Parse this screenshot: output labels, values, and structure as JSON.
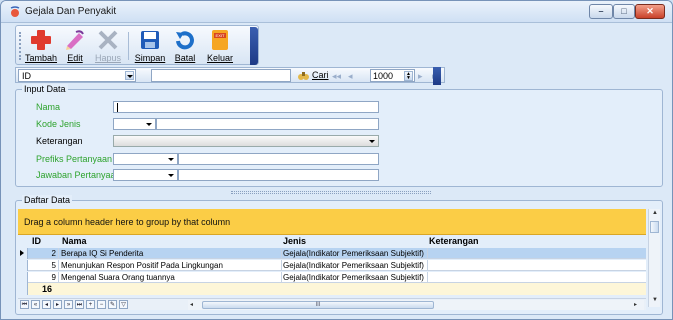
{
  "window": {
    "title": "Gejala Dan Penyakit"
  },
  "toolbar": {
    "tambah": "Tambah",
    "edit": "Edit",
    "hapus": "Hapus",
    "simpan": "Simpan",
    "batal": "Batal",
    "keluar": "Keluar"
  },
  "findbar": {
    "field": "ID",
    "cari": "Cari",
    "count": "1000"
  },
  "input_group": {
    "title": "Input Data",
    "nama": "Nama",
    "kode_jenis": "Kode Jenis",
    "keterangan": "Keterangan",
    "prefiks": "Prefiks Pertanyaan",
    "jawaban": "Jawaban Pertanyaan"
  },
  "list_group": {
    "title": "Daftar Data",
    "group_hint": "Drag a column header here to group by that column",
    "columns": {
      "id": "ID",
      "nama": "Nama",
      "jenis": "Jenis",
      "keterangan": "Keterangan"
    },
    "rows": [
      {
        "id": "2",
        "nama": "Berapa IQ Si Penderita",
        "jenis": "Gejala(Indikator Pemeriksaan Subjektif)",
        "keterangan": ""
      },
      {
        "id": "5",
        "nama": "Menunjukan Respon Positif Pada Lingkungan",
        "jenis": "Gejala(Indikator Pemeriksaan Subjektif)",
        "keterangan": ""
      },
      {
        "id": "9",
        "nama": "Mengenal Suara Orang tuannya",
        "jenis": "Gejala(Indikator Pemeriksaan Subjektif)",
        "keterangan": ""
      }
    ],
    "footer_total": "16",
    "scroll_grip": "III"
  },
  "icons": {
    "app": "stethoscope-icon",
    "add": "plus-icon",
    "edit": "pencil-icon",
    "delete": "x-icon",
    "save": "floppy-icon",
    "undo": "undo-icon",
    "exit": "exit-icon",
    "find": "binoculars-icon"
  },
  "colors": {
    "group_bar": "#fbcd46",
    "selected_row": "#b7d3f1",
    "label_green": "#2ea32e"
  }
}
